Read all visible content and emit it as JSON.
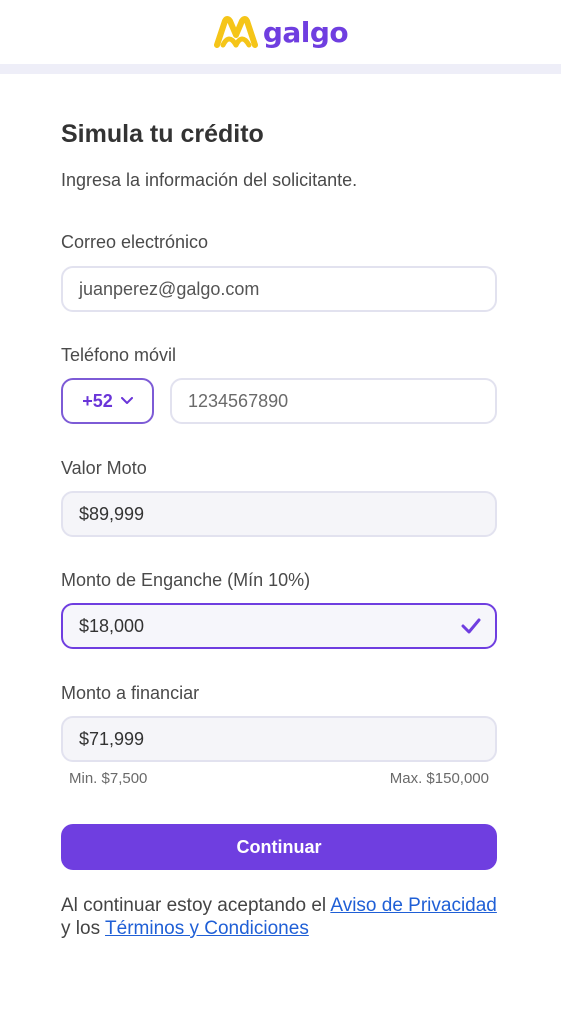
{
  "header": {
    "brand": "galgo",
    "accent_color": "#6f3ee0",
    "logo_icon": "galgo-logo-mark"
  },
  "form": {
    "title": "Simula tu crédito",
    "subtitle": "Ingresa la información del solicitante.",
    "email": {
      "label": "Correo electrónico",
      "placeholder": "juanperez@galgo.com"
    },
    "phone": {
      "label": "Teléfono móvil",
      "country_code": "+52",
      "placeholder": "1234567890"
    },
    "moto_value": {
      "label": "Valor Moto",
      "value": "$89,999"
    },
    "down_payment": {
      "label": "Monto de Enganche (Mín 10%)",
      "value": "$18,000",
      "status_icon": "checkmark-icon"
    },
    "finance_amount": {
      "label": "Monto a financiar",
      "value": "$71,999",
      "min": "Min. $7,500",
      "max": "Max. $150,000"
    },
    "submit_label": "Continuar"
  },
  "legal": {
    "prefix": "Al continuar estoy aceptando el ",
    "privacy_link": "Aviso de Privacidad",
    "middle": " y los ",
    "terms_link": "Términos y Condiciones"
  }
}
